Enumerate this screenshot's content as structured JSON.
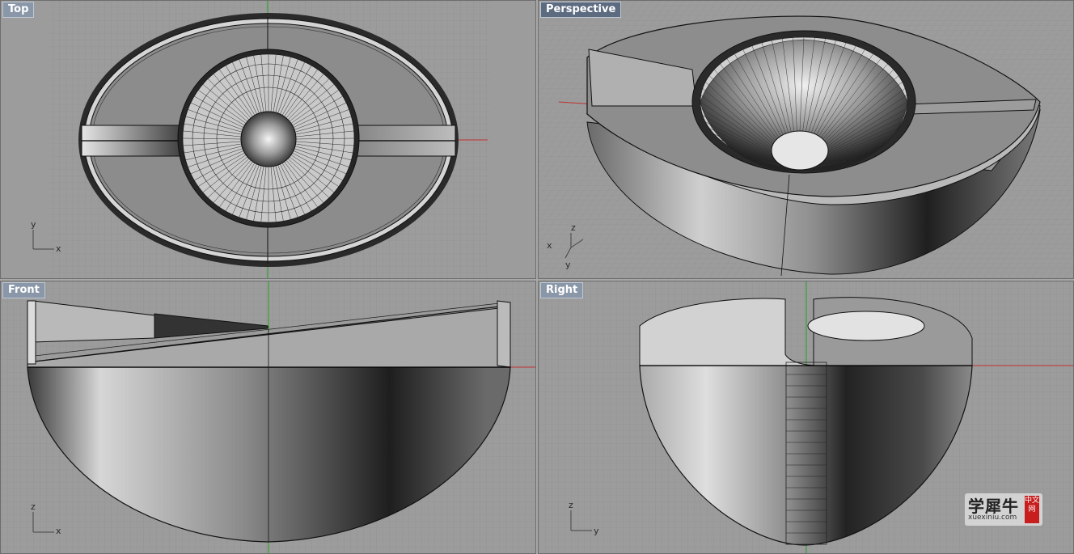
{
  "viewports": {
    "top": {
      "label": "Top",
      "axis_h": "x",
      "axis_v": "y"
    },
    "perspective": {
      "label": "Perspective",
      "axis_a": "z",
      "axis_b": "x",
      "axis_c": "y"
    },
    "front": {
      "label": "Front",
      "axis_h": "x",
      "axis_v": "z"
    },
    "right": {
      "label": "Right",
      "axis_h": "y",
      "axis_v": "z"
    }
  },
  "watermark": {
    "chinese": "学犀牛",
    "url": "xuexiniu.com",
    "badge": "中文网"
  },
  "colors": {
    "viewport_bg": "#9c9c9c",
    "grid": "#8e8e8e",
    "axis_x": "#c03030",
    "axis_y": "#20a020",
    "label_bg": "#8a97a8",
    "active_label_bg": "#5d6b80"
  }
}
